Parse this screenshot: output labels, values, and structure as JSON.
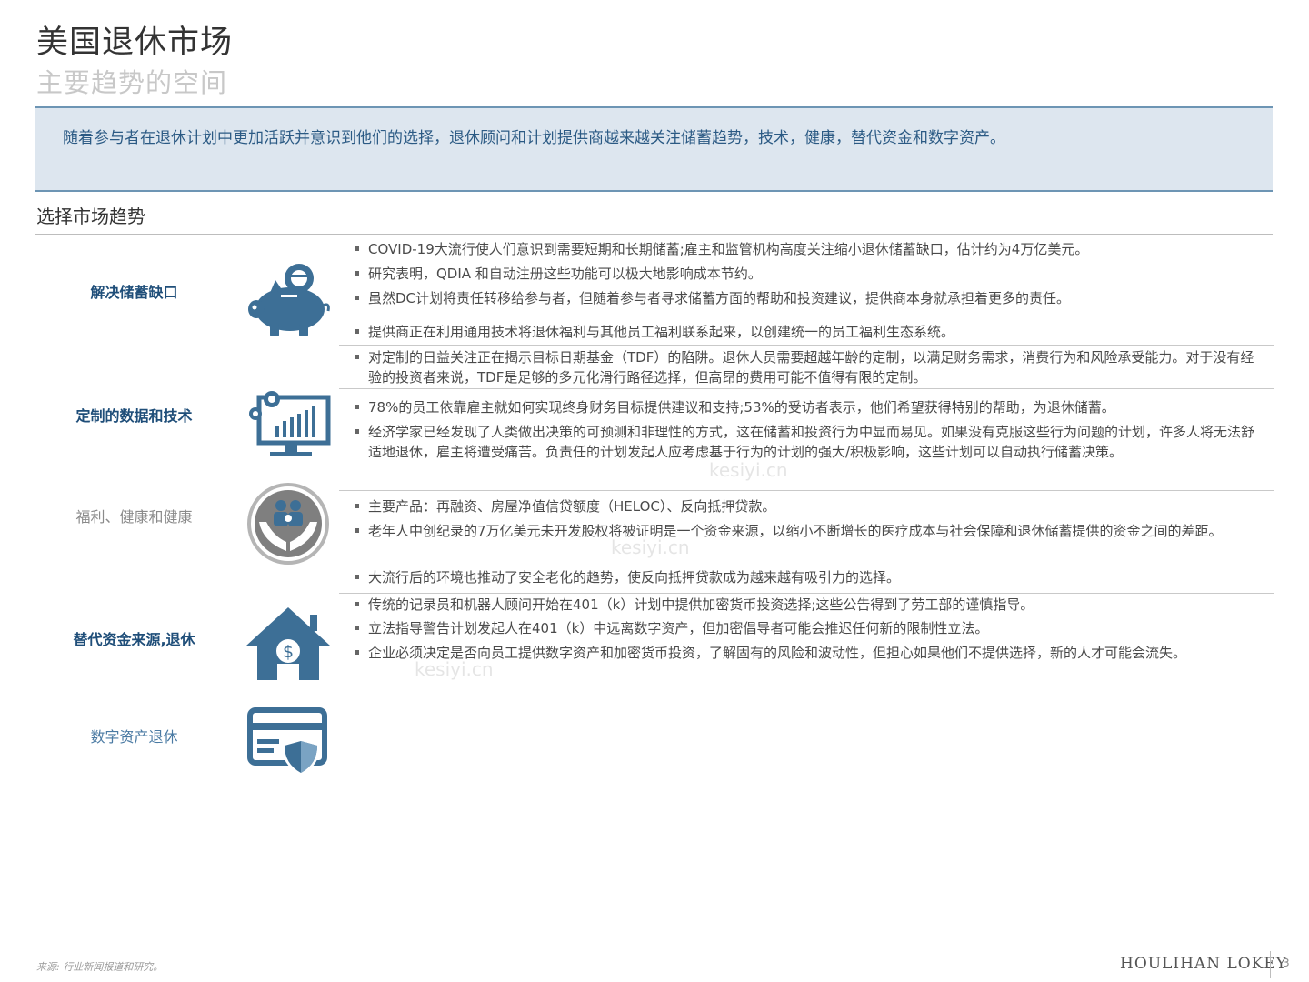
{
  "header": {
    "title": "美国退休市场",
    "subtitle": "主要趋势的空间"
  },
  "banner": {
    "text": "随着参与者在退休计划中更加活跃并意识到他们的选择，退休顾问和计划提供商越来越关注储蓄趋势，技术，健康，替代资金和数字资产。"
  },
  "section": {
    "title": "选择市场趋势"
  },
  "rows": [
    {
      "label": "解决储蓄缺口",
      "icon": "piggy-bank-icon"
    },
    {
      "label": "定制的数据和技术",
      "icon": "monitor-chart-gears-icon"
    },
    {
      "label": "福利、健康和健康",
      "icon": "family-in-hands-icon"
    },
    {
      "label": "替代资金来源,退休",
      "icon": "house-dollar-icon"
    },
    {
      "label": "数字资产退休",
      "icon": "card-shield-icon"
    }
  ],
  "bullets": [
    "COVID-19大流行使人们意识到需要短期和长期储蓄;雇主和监管机构高度关注缩小退休储蓄缺口，估计约为4万亿美元。",
    "研究表明，QDIA 和自动注册这些功能可以极大地影响成本节约。",
    "虽然DC计划将责任转移给参与者，但随着参与者寻求储蓄方面的帮助和投资建议，提供商本身就承担着更多的责任。",
    "提供商正在利用通用技术将退休福利与其他员工福利联系起来，以创建统一的员工福利生态系统。",
    "对定制的日益关注正在揭示目标日期基金（TDF）的陷阱。退休人员需要超越年龄的定制，以满足财务需求，消费行为和风险承受能力。对于没有经验的投资者来说，TDF是足够的多元化滑行路径选择，但高昂的费用可能不值得有限的定制。",
    "78%的员工依靠雇主就如何实现终身财务目标提供建议和支持;53%的受访者表示，他们希望获得特别的帮助，为退休储蓄。",
    "经济学家已经发现了人类做出决策的可预测和非理性的方式，这在储蓄和投资行为中显而易见。如果没有克服这些行为问题的计划，许多人将无法舒适地退休，雇主将遭受痛苦。负责任的计划发起人应考虑基于行为的计划的强大/积极影响，这些计划可以自动执行储蓄决策。",
    "主要产品：再融资、房屋净值信贷额度（HELOC）、反向抵押贷款。",
    "老年人中创纪录的7万亿美元未开发股权将被证明是一个资金来源，以缩小不断增长的医疗成本与社会保障和退休储蓄提供的资金之间的差距。",
    "大流行后的环境也推动了安全老化的趋势，使反向抵押贷款成为越来越有吸引力的选择。",
    "传统的记录员和机器人顾问开始在401（k）计划中提供加密货币投资选择;这些公告得到了劳工部的谨慎指导。",
    "立法指导警告计划发起人在401（k）中远离数字资产，但加密倡导者可能会推迟任何新的限制性立法。",
    "企业必须决定是否向员工提供数字资产和加密货币投资，了解固有的风险和波动性，但担心如果他们不提供选择，新的人才可能会流失。"
  ],
  "watermark": "kesiyi.cn",
  "footer": {
    "source": "来源: 行业新闻报道和研究。",
    "brand": "HOULIHAN LOKEY",
    "page": "3"
  },
  "colors": {
    "accent": "#1f4e79",
    "icon": "#3d6f96",
    "banner_bg": "#dde6ef",
    "banner_border": "#6d95b4"
  }
}
